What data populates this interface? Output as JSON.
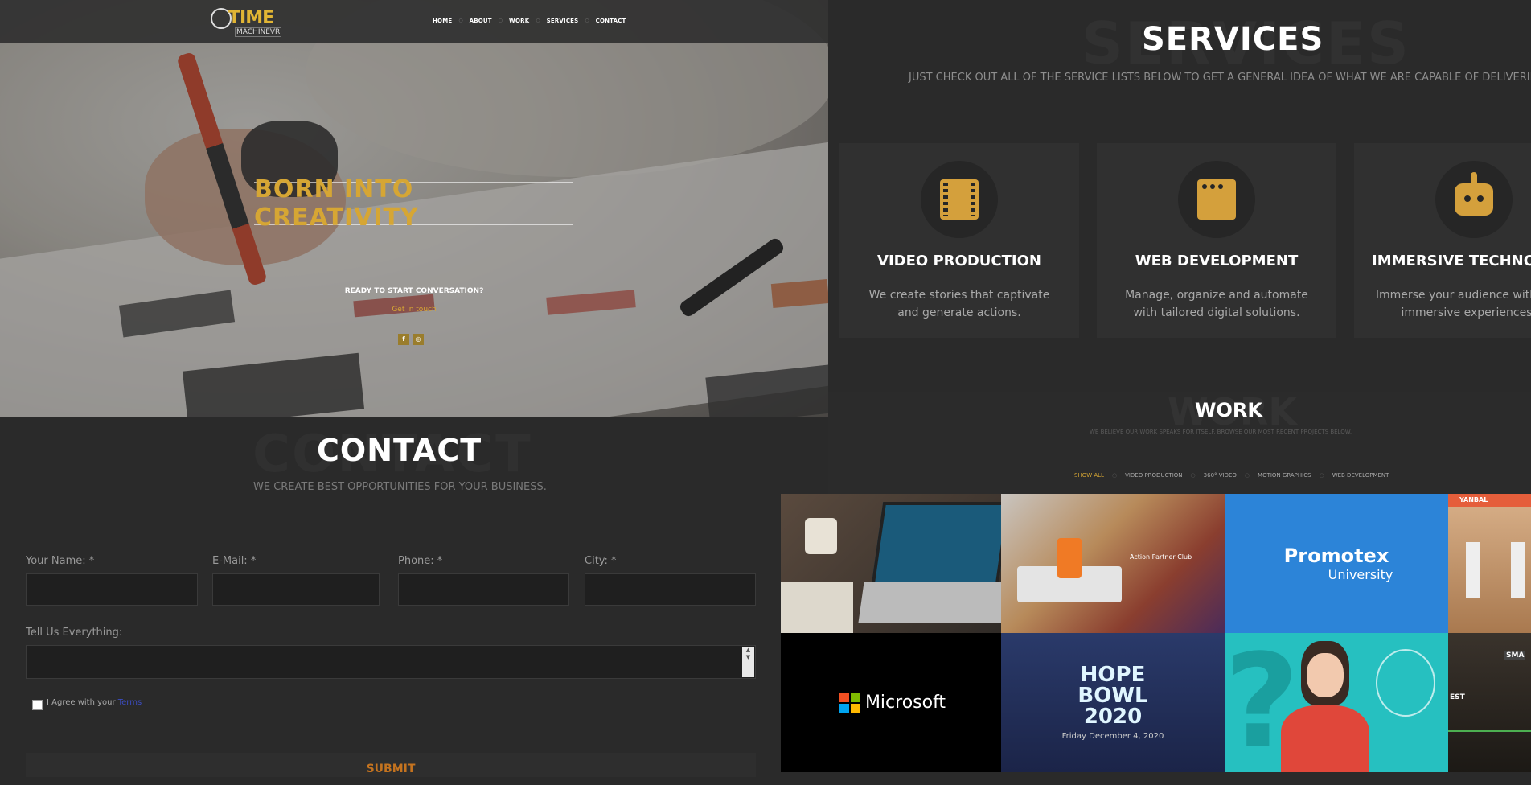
{
  "header": {
    "logo_big": "TIME",
    "logo_small": "MACHINEVR",
    "nav": [
      "HOME",
      "ABOUT",
      "WORK",
      "SERVICES",
      "CONTACT"
    ]
  },
  "hero": {
    "title": "BORN INTO CREATIVITY",
    "question": "READY TO START CONVERSATION?",
    "link": "Get in touch",
    "social": [
      "f",
      "◎"
    ]
  },
  "services": {
    "bg_word": "SERVICES",
    "title": "SERVICES",
    "subtitle": "JUST CHECK OUT ALL OF THE SERVICE LISTS BELOW TO GET A GENERAL IDEA OF WHAT WE ARE CAPABLE OF DELIVERING.",
    "items": [
      {
        "title": "VIDEO PRODUCTION",
        "text": "We create stories that captivate and generate actions.",
        "icon": "film-icon"
      },
      {
        "title": "WEB DEVELOPMENT",
        "text": "Manage, organize and automate with tailored digital solutions.",
        "icon": "browser-icon"
      },
      {
        "title": "IMMERSIVE TECHNOL",
        "text": "Immerse your audience with hig immersive experiences",
        "icon": "robot-icon"
      }
    ]
  },
  "work": {
    "bg_word": "WORK",
    "title": "WORK",
    "subtitle": "WE BELIEVE OUR WORK SPEAKS FOR ITSELF. BROWSE OUR MOST RECENT PROJECTS BELOW.",
    "filters": [
      "SHOW ALL",
      "VIDEO PRODUCTION",
      "360° VIDEO",
      "MOTION GRAPHICS",
      "WEB DEVELOPMENT"
    ],
    "tiles": {
      "action_title": "Action Partner Club",
      "promotex": "Promotex",
      "promotex_sub": "University",
      "yanbal": "YANBAL",
      "microsoft": "Microsoft",
      "hope1": "HOPE",
      "hope2": "BOWL",
      "hope3": "2020",
      "hope_date": "Friday December 4, 2020",
      "sma": "SMA",
      "est": "EST"
    }
  },
  "contact": {
    "bg_word": "CONTACT",
    "title": "CONTACT",
    "subtitle": "WE CREATE BEST OPPORTUNITIES FOR YOUR BUSINESS.",
    "fields": {
      "name_label": "Your Name: *",
      "email_label": "E-Mail: *",
      "phone_label": "Phone: *",
      "city_label": "City: *",
      "message_label": "Tell Us Everything:"
    },
    "agree_text": "I Agree with your ",
    "agree_link": "Terms",
    "submit": "SUBMIT"
  },
  "colors": {
    "accent": "#d6a634",
    "background": "#2a2a2a",
    "card": "#303030"
  }
}
